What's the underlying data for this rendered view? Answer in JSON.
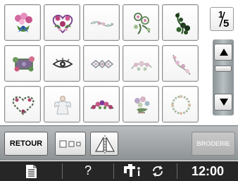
{
  "pattern_grid": {
    "patterns": [
      {
        "icon": "bouquet-with-bow-embroidery-icon"
      },
      {
        "icon": "heart-with-roses-embroidery-icon"
      },
      {
        "icon": "floral-border-embroidery-icon"
      },
      {
        "icon": "flower-spray-embroidery-icon"
      },
      {
        "icon": "flower-vine-embroidery-icon"
      },
      {
        "icon": "floral-frame-embroidery-icon"
      },
      {
        "icon": "eye-motif-embroidery-icon"
      },
      {
        "icon": "ornament-border-embroidery-icon"
      },
      {
        "icon": "lace-flowers-embroidery-icon"
      },
      {
        "icon": "flowering-branch-embroidery-icon"
      },
      {
        "icon": "heart-wreath-embroidery-icon"
      },
      {
        "icon": "angel-embroidery-icon"
      },
      {
        "icon": "floral-garland-embroidery-icon"
      },
      {
        "icon": "floral-bouquet-embroidery-icon"
      },
      {
        "icon": "round-wreath-embroidery-icon"
      }
    ]
  },
  "pagination": {
    "current": "1",
    "total": "5"
  },
  "scrollbar": {
    "up_icon": "triangle-up-icon",
    "down_icon": "triangle-down-icon",
    "scroll_position_fraction": 0
  },
  "buttons": {
    "retour": "RETOUR",
    "layout_icon": "boxes-size-icon",
    "mirror_icon": "mirror-image-icon",
    "broderie": "BRODERIE"
  },
  "status_bar": {
    "doc_icon": "document-icon",
    "help": "?",
    "machine_icon": "sewing-machine-thread-icon",
    "rotate_icon": "rotate-arrows-icon",
    "clock": "12:00"
  },
  "colors": {
    "button_bar": "#a3a8aa",
    "status_bar": "#262626",
    "disabled_button": "#bdbdbd"
  }
}
